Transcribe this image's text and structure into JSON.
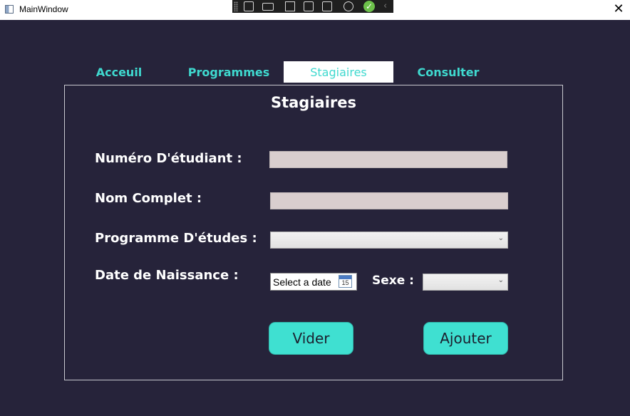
{
  "window": {
    "title": "MainWindow",
    "close_symbol": "✕"
  },
  "devtools": {
    "icons": [
      "select-element-icon",
      "camera-icon",
      "pointer-icon",
      "layout-adorner-icon",
      "track-focus-icon",
      "hot-reload-icon",
      "check-icon",
      "chevron-left-icon"
    ]
  },
  "tabs": [
    {
      "label": "Acceuil",
      "selected": false
    },
    {
      "label": "Programmes",
      "selected": false
    },
    {
      "label": "Stagiaires",
      "selected": true
    },
    {
      "label": "Consulter",
      "selected": false
    }
  ],
  "form": {
    "title": "Stagiaires",
    "student_number": {
      "label": "Numéro D'étudiant :",
      "value": ""
    },
    "full_name": {
      "label": "Nom Complet :",
      "value": ""
    },
    "program": {
      "label": "Programme D'études :",
      "value": ""
    },
    "birth_date": {
      "label": "Date de Naissance :",
      "placeholder": "Select a date",
      "calendar_day": "15"
    },
    "sex": {
      "label": "Sexe :",
      "value": ""
    },
    "clear_button": "Vider",
    "add_button": "Ajouter"
  },
  "colors": {
    "background": "#26233a",
    "accent": "#3fe0d1",
    "tab_text": "#3fd9cf",
    "input_fill": "#d9cece"
  }
}
